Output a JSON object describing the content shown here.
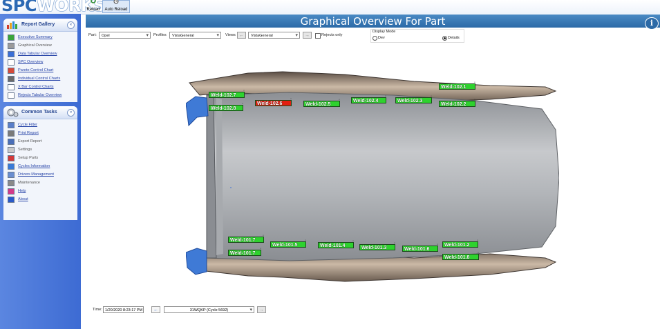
{
  "app": {
    "logo_dark": "SPC",
    "logo_light": "WORKS"
  },
  "toolbar": {
    "reload_label": "Reload",
    "auto_reload_label": "Auto Reload"
  },
  "sidebar": {
    "report_gallery": {
      "title": "Report Gallery",
      "items": [
        {
          "label": "Executive Summary",
          "icon": "executive-summary-icon"
        },
        {
          "label": "Graphical Overview",
          "icon": "graphical-overview-icon"
        },
        {
          "label": "Data Tabular Overview",
          "icon": "data-tabular-icon"
        },
        {
          "label": "SPC Overview",
          "icon": "spc-overview-icon"
        },
        {
          "label": "Pareto Control Chart",
          "icon": "pareto-chart-icon"
        },
        {
          "label": "Individual Control Charts",
          "icon": "individual-chart-icon"
        },
        {
          "label": "X Bar Control Charts",
          "icon": "xbar-chart-icon"
        },
        {
          "label": "Rejects Tabular Overview",
          "icon": "rejects-tabular-icon"
        }
      ]
    },
    "common_tasks": {
      "title": "Common Tasks",
      "items": [
        {
          "label": "Cycle Filter",
          "icon": "cycle-filter-icon"
        },
        {
          "label": "Print Report",
          "icon": "printer-icon"
        },
        {
          "label": "Export Report",
          "icon": "export-icon"
        },
        {
          "label": "Settings",
          "icon": "settings-icon"
        },
        {
          "label": "Setup Parts",
          "icon": "setup-parts-icon"
        },
        {
          "label": "Cycles Information",
          "icon": "cycles-info-icon"
        },
        {
          "label": "Drivers Management",
          "icon": "drivers-icon"
        },
        {
          "label": "Maintenance",
          "icon": "maintenance-icon"
        },
        {
          "label": "Help",
          "icon": "help-icon"
        },
        {
          "label": "About",
          "icon": "about-icon"
        }
      ]
    }
  },
  "header": {
    "title": "Graphical Overview For Part"
  },
  "filters": {
    "part_label": "Part:",
    "part_value": "Opel",
    "profiles_label": "Profiles",
    "profiles_value": "VistaGeneral",
    "views_label": "Views",
    "views_value": "VistaGeneral",
    "rejects_only_label": "Rejects only"
  },
  "display_mode": {
    "title": "Display Mode",
    "options": [
      {
        "label": "Dev",
        "selected": false
      },
      {
        "label": "Details",
        "selected": true
      }
    ]
  },
  "welds": [
    {
      "label": "Weld-102.7",
      "status": "ok"
    },
    {
      "label": "Weld-102.8",
      "status": "ok"
    },
    {
      "label": "Weld-102.6",
      "status": "reject"
    },
    {
      "label": "Weld-102.5",
      "status": "ok"
    },
    {
      "label": "Weld-102.4",
      "status": "ok"
    },
    {
      "label": "Weld-102.3",
      "status": "ok"
    },
    {
      "label": "Weld-102.1",
      "status": "ok"
    },
    {
      "label": "Weld-102.2",
      "status": "ok"
    },
    {
      "label": "Weld-101.7",
      "status": "ok"
    },
    {
      "label": "Weld-101.7",
      "status": "ok"
    },
    {
      "label": "Weld-101.5",
      "status": "ok"
    },
    {
      "label": "Weld-101.4",
      "status": "ok"
    },
    {
      "label": "Weld-101.3",
      "status": "ok"
    },
    {
      "label": "Weld-101.6",
      "status": "ok"
    },
    {
      "label": "Weld-101.2",
      "status": "ok"
    },
    {
      "label": "Weld-101.8",
      "status": "ok"
    }
  ],
  "footer": {
    "time_label": "Time:",
    "time_value": "1/20/2020 8:23:17 PM",
    "cycle_value": "31WQKP (Cycle 5692)"
  },
  "colors": {
    "accent": "#2c6aa7",
    "sidebar": "#4a78d8",
    "weld_ok": "#2ed22e",
    "weld_reject": "#e31e10"
  }
}
